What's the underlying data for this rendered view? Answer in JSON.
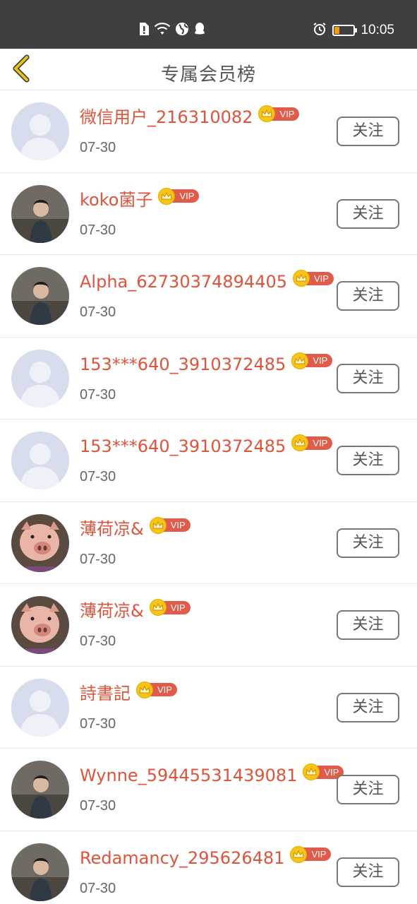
{
  "status_bar": {
    "time": "10:05",
    "icons": [
      "sim-alert-icon",
      "wifi-icon",
      "globe-icon",
      "qq-icon"
    ],
    "right_icons": [
      "alarm-icon",
      "battery-icon"
    ],
    "battery_level": 0.25,
    "battery_color": "#f39c12"
  },
  "header": {
    "title": "专属会员榜",
    "back_icon": "chevron-left-icon",
    "back_color": "#e5c31a"
  },
  "colors": {
    "name": "#e0533a",
    "vip_badge": "#e05b4a",
    "coin": "#f5c518",
    "default_avatar_bg": "#d9dfee"
  },
  "members": [
    {
      "name": "微信用户_216310082",
      "badge": "VIP",
      "date": "07-30",
      "follow_label": "关注",
      "avatar": "default-avatar"
    },
    {
      "name": "koko菌子",
      "badge": "VIP",
      "date": "07-30",
      "follow_label": "关注",
      "avatar": "photo-avatar"
    },
    {
      "name": "Alpha_62730374894405",
      "badge": "VIP",
      "date": "07-30",
      "follow_label": "关注",
      "avatar": "photo-avatar"
    },
    {
      "name": "153***640_3910372485",
      "badge": "VIP",
      "date": "07-30",
      "follow_label": "关注",
      "avatar": "default-avatar"
    },
    {
      "name": "153***640_3910372485",
      "badge": "VIP",
      "date": "07-30",
      "follow_label": "关注",
      "avatar": "default-avatar"
    },
    {
      "name": "薄荷凉&",
      "badge": "VIP",
      "date": "07-30",
      "follow_label": "关注",
      "avatar": "pig-avatar"
    },
    {
      "name": "薄荷凉&",
      "badge": "VIP",
      "date": "07-30",
      "follow_label": "关注",
      "avatar": "pig-avatar"
    },
    {
      "name": "詩書記",
      "badge": "VIP",
      "date": "07-30",
      "follow_label": "关注",
      "avatar": "default-avatar"
    },
    {
      "name": "Wynne_59445531439081",
      "badge": "VIP",
      "date": "07-30",
      "follow_label": "关注",
      "avatar": "photo-avatar"
    },
    {
      "name": "Redamancy_295626481",
      "badge": "VIP",
      "date": "07-30",
      "follow_label": "关注",
      "avatar": "photo-avatar"
    }
  ]
}
